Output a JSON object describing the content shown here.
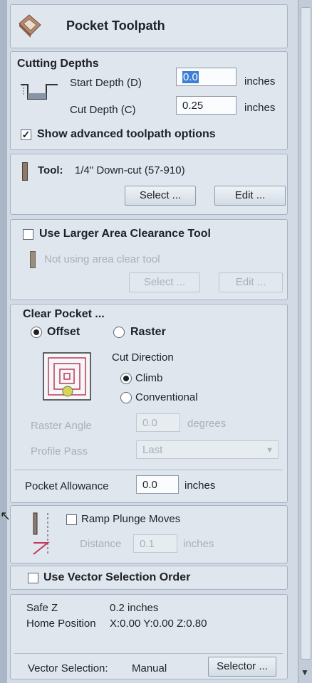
{
  "header": {
    "title": "Pocket Toolpath"
  },
  "cutting_depths": {
    "title": "Cutting Depths",
    "start_depth_label": "Start Depth (D)",
    "start_depth_value": "0.0",
    "start_units": "inches",
    "cut_depth_label": "Cut Depth (C)",
    "cut_depth_value": "0.25",
    "cut_units": "inches",
    "advanced_label": "Show advanced toolpath options",
    "advanced_checked": true
  },
  "tool": {
    "label": "Tool:",
    "name": "1/4\" Down-cut (57-910)",
    "select_label": "Select ...",
    "edit_label": "Edit ..."
  },
  "area_clear": {
    "label": "Use Larger Area Clearance Tool",
    "status": "Not using area clear tool",
    "select_label": "Select ...",
    "edit_label": "Edit ..."
  },
  "clear_pocket": {
    "title": "Clear Pocket ...",
    "offset_label": "Offset",
    "raster_label": "Raster",
    "cut_direction_label": "Cut Direction",
    "climb_label": "Climb",
    "conventional_label": "Conventional",
    "raster_angle_label": "Raster Angle",
    "raster_angle_value": "0.0",
    "raster_angle_units": "degrees",
    "profile_pass_label": "Profile Pass",
    "profile_pass_value": "Last",
    "allowance_label": "Pocket Allowance",
    "allowance_value": "0.0",
    "allowance_units": "inches"
  },
  "ramp": {
    "label": "Ramp Plunge Moves",
    "distance_label": "Distance",
    "distance_value": "0.1",
    "distance_units": "inches"
  },
  "vector_order": {
    "label": "Use Vector Selection Order"
  },
  "info": {
    "safe_z_label": "Safe Z",
    "safe_z_value": "0.2 inches",
    "home_label": "Home Position",
    "home_value": "X:0.00 Y:0.00 Z:0.80"
  },
  "footer": {
    "vector_selection_label": "Vector Selection:",
    "vector_selection_value": "Manual",
    "selector_label": "Selector ..."
  },
  "colors": {
    "accent": "#c0395a",
    "panel": "#dfe6ee",
    "background": "#d2dae5"
  }
}
